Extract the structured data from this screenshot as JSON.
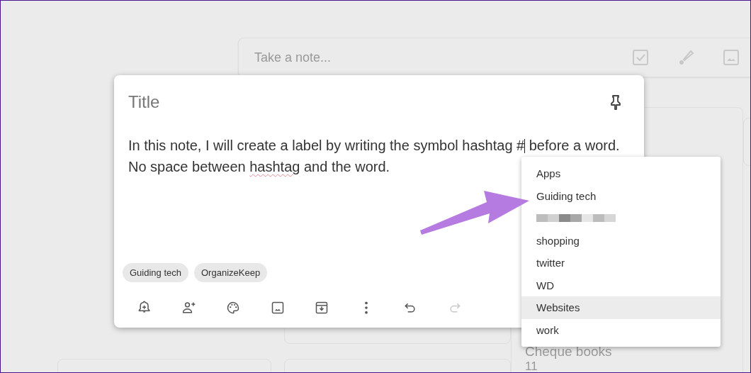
{
  "take_note": {
    "placeholder": "Take a note...",
    "tools": [
      {
        "kind": "checkbox"
      },
      {
        "kind": "brush"
      },
      {
        "kind": "image"
      }
    ]
  },
  "background_note": {
    "title": "Cheque books",
    "text": "11"
  },
  "editor": {
    "title_placeholder": "Title",
    "pinned": false,
    "body_lines": [
      [
        {
          "text": "In this note, I will create a label by writing the symbol hashtag #"
        },
        {
          "kind": "caret"
        },
        {
          "text": " before a word."
        }
      ],
      [
        {
          "text": "No space between "
        },
        {
          "text": "hashtag",
          "misspelled": true
        },
        {
          "text": " and the word."
        }
      ]
    ],
    "labels": [
      "Guiding tech",
      "OrganizeKeep"
    ],
    "tools": [
      {
        "kind": "reminder",
        "disabled": false
      },
      {
        "kind": "collaborator",
        "disabled": false
      },
      {
        "kind": "palette",
        "disabled": false
      },
      {
        "kind": "image",
        "disabled": false
      },
      {
        "kind": "archive",
        "disabled": false
      },
      {
        "kind": "more",
        "disabled": false
      },
      {
        "kind": "undo",
        "disabled": false
      },
      {
        "kind": "redo",
        "disabled": true
      }
    ]
  },
  "label_menu": {
    "items": [
      {
        "kind": "label",
        "text": "Apps",
        "selected": false
      },
      {
        "kind": "label",
        "text": "Guiding tech",
        "selected": false
      },
      {
        "kind": "redacted",
        "selected": false
      },
      {
        "kind": "label",
        "text": "shopping",
        "selected": false
      },
      {
        "kind": "label",
        "text": "twitter",
        "selected": false
      },
      {
        "kind": "label",
        "text": "WD",
        "selected": false
      },
      {
        "kind": "label",
        "text": "Websites",
        "selected": true
      },
      {
        "kind": "label",
        "text": "work",
        "selected": false
      }
    ]
  },
  "annotation": {
    "kind": "arrow",
    "color": "#b57be0"
  }
}
